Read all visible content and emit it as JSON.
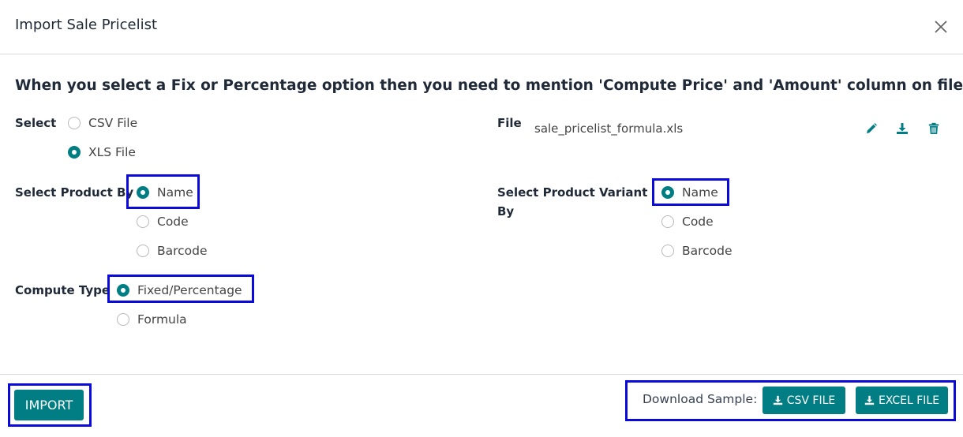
{
  "dialog": {
    "title": "Import Sale Pricelist",
    "instruction": "When you select a Fix or Percentage option then you need to mention 'Compute Price' and 'Amount' column on file."
  },
  "select_file_type": {
    "label": "Select",
    "options": [
      {
        "label": "CSV File",
        "checked": false
      },
      {
        "label": "XLS File",
        "checked": true
      }
    ]
  },
  "file": {
    "label": "File",
    "filename": "sale_pricelist_formula.xls",
    "actions": [
      "edit-icon",
      "download-icon",
      "trash-icon"
    ]
  },
  "product_by": {
    "label": "Select Product By",
    "options": [
      {
        "label": "Name",
        "checked": true
      },
      {
        "label": "Code",
        "checked": false
      },
      {
        "label": "Barcode",
        "checked": false
      }
    ]
  },
  "variant_by": {
    "label_line1": "Select Product Variant",
    "label_line2": "By",
    "options": [
      {
        "label": "Name",
        "checked": true
      },
      {
        "label": "Code",
        "checked": false
      },
      {
        "label": "Barcode",
        "checked": false
      }
    ]
  },
  "compute_type": {
    "label": "Compute Type",
    "options": [
      {
        "label": "Fixed/Percentage",
        "checked": true
      },
      {
        "label": "Formula",
        "checked": false
      }
    ]
  },
  "footer": {
    "import_label": "IMPORT",
    "download_label": "Download Sample:",
    "csv_label": "CSV FILE",
    "excel_label": "EXCEL FILE"
  },
  "colors": {
    "accent": "#017e84",
    "highlight": "#0a0adb"
  }
}
